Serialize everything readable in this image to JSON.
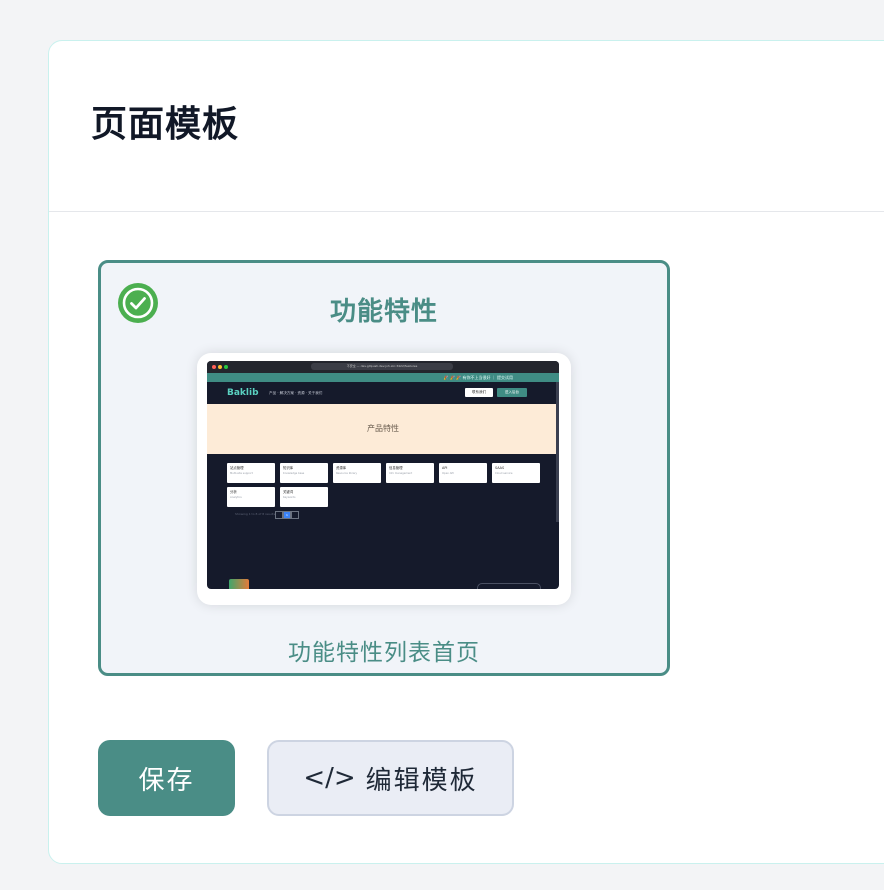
{
  "page": {
    "title": "页面模板"
  },
  "template_card": {
    "selected": true,
    "name": "功能特性",
    "description": "功能特性列表首页",
    "accent_color": "#4a8d86",
    "check_color": "#4caf50",
    "thumbnail": {
      "url": "不安全 — dev.gitpush.dev.jvh.xin:3422/features",
      "banner": "🎉 🎉 🎉 有你不上当很好 ｜ 提交试用",
      "logo": "Baklib",
      "menu": "产品 ·  解决方案 ·  资源 ·  关于我们",
      "contact_label": "联系我们",
      "login_label": "进入后台",
      "hero_title": "产品特性",
      "cards": [
        {
          "title": "站点管理",
          "sub": "Multi-site support"
        },
        {
          "title": "知识库",
          "sub": "Knowledge base"
        },
        {
          "title": "资源库",
          "sub": "Resource library"
        },
        {
          "title": "信息管理",
          "sub": "Info management"
        },
        {
          "title": "API",
          "sub": "Open API"
        },
        {
          "title": "SAAS",
          "sub": "Cloud service"
        },
        {
          "title": "分析",
          "sub": "Analytics"
        },
        {
          "title": "关键词",
          "sub": "Keywords"
        }
      ],
      "pagination_text": "Showing 1 to 8 of 8 results",
      "current_page": "1"
    }
  },
  "actions": {
    "save_label": "保存",
    "edit_label": "编辑模板",
    "edit_icon": "</>"
  }
}
